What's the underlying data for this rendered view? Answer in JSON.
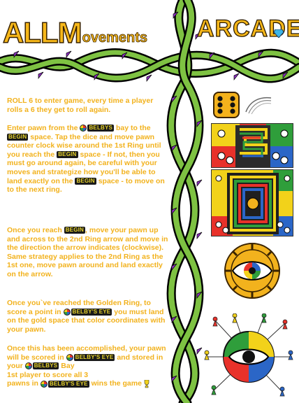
{
  "header": {
    "logo_left_big_1": "ALL",
    "logo_left_big_2": "M",
    "logo_left_small": "ovements",
    "logo_right": "ARCADE"
  },
  "rules": {
    "p1": "ROLL 6 to enter game, every time a player rolls a 6 they get to roll again.",
    "p2_a": "Enter pawn from the",
    "p2_b": "bay to the",
    "p2_c": "space. Tap the dice and move pawn counter clock wise around the 1st Ring until you reach the",
    "p2_d": "space - If not, then you must go around again, be careful with your moves and strategize how you'll be able to land exactly on the",
    "p2_e": "space - to move on to the next ring.",
    "p3_a": "Once you reach",
    "p3_b": ", move your pawn up and across to the 2nd Ring arrow and move in the direction the arrow indicates (clockwise). Same strategy applies to the 2nd Ring as the 1st one, move pawn around and land exactly on the arrow.",
    "p4_a": "Once you`ve reached the Golden Ring, to score a point in",
    "p4_b": "you must land on the gold space that color coordinates with your pawn.",
    "p5_a": "Once this has been accomplished, your pawn will be scored in",
    "p5_b": "and stored in your",
    "p5_c": "Bay",
    "p6_a": "1st player to score all 3",
    "p6_b": "pawns in",
    "p6_c": "wins the game"
  },
  "chips": {
    "begin": "BEGIN",
    "belbys": "BELBYS",
    "belbys_eye": "BELBY'S EYE"
  },
  "colors": {
    "vine_green": "#7ec242",
    "vine_dark": "#0a0a0a",
    "thorn_purple": "#8e2fc2",
    "text_gold": "#f2b21d",
    "board_red": "#e8312a",
    "board_blue": "#2b66c7",
    "board_green": "#2f9e3b",
    "board_yellow": "#f2d21a"
  },
  "icons": {
    "dice": "dice-icon",
    "eye": "belbys-eye-icon",
    "trophy": "trophy-icon"
  }
}
